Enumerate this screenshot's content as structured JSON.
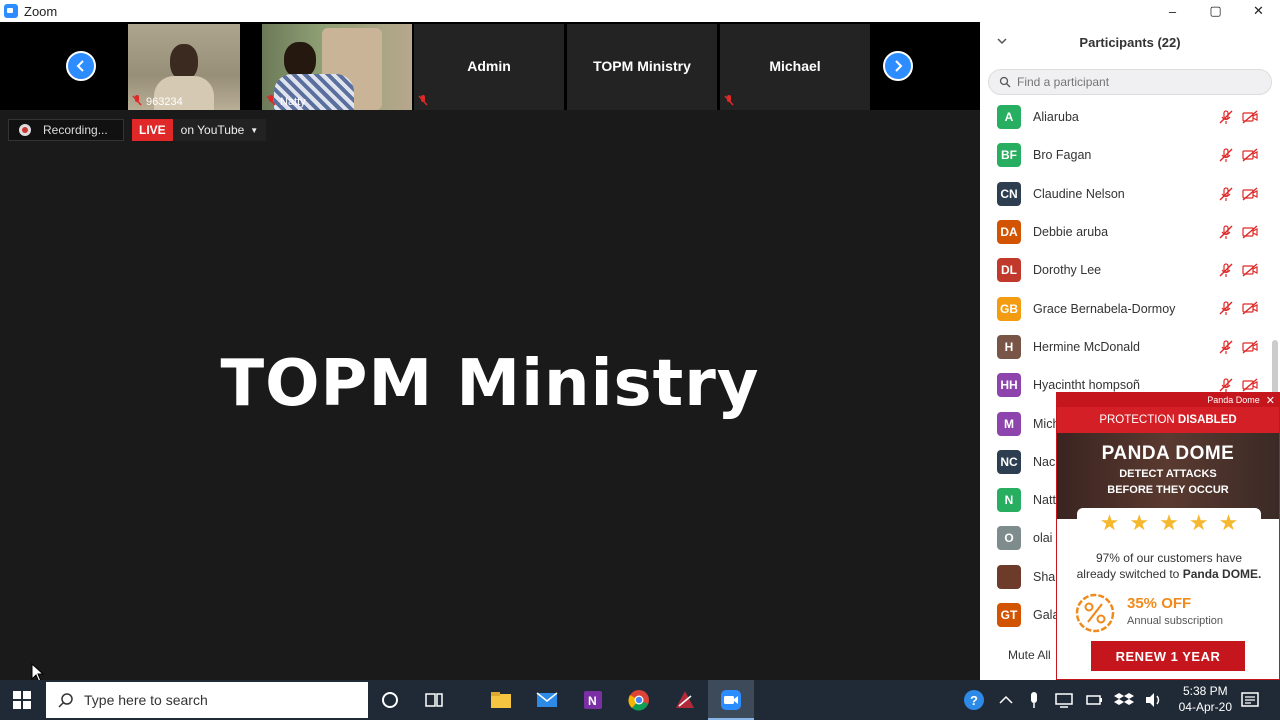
{
  "window": {
    "title": "Zoom",
    "controls": [
      "–",
      "▢",
      "✕"
    ]
  },
  "gallery": {
    "tiles": [
      {
        "name": "963234",
        "muted": true
      },
      {
        "name": "Natty",
        "muted": true
      },
      {
        "name": "Admin",
        "muted": true
      },
      {
        "name": "TOPM Ministry",
        "muted": false
      },
      {
        "name": "Michael",
        "muted": true
      }
    ]
  },
  "recording": {
    "label": "Recording..."
  },
  "live": {
    "badge": "LIVE",
    "destination": "on YouTube"
  },
  "speaker": {
    "name": "TOPM Ministry"
  },
  "participants": {
    "title": "Participants (22)",
    "search_placeholder": "Find a participant",
    "mute_all_label": "Mute All",
    "list": [
      {
        "initials": "A",
        "name": "Aliaruba",
        "color": "#27ae60"
      },
      {
        "initials": "BF",
        "name": "Bro Fagan",
        "color": "#27ae60"
      },
      {
        "initials": "CN",
        "name": "Claudine Nelson",
        "color": "#2c3e50"
      },
      {
        "initials": "DA",
        "name": "Debbie aruba",
        "color": "#d35400"
      },
      {
        "initials": "DL",
        "name": "Dorothy Lee",
        "color": "#c0392b"
      },
      {
        "initials": "GB",
        "name": "Grace Bernabela-Dormoy",
        "color": "#f39c12"
      },
      {
        "initials": "H",
        "name": "Hermine McDonald",
        "color": "#795548"
      },
      {
        "initials": "HH",
        "name": "Hyacintht hompsoñ",
        "color": "#8e44ad"
      },
      {
        "initials": "M",
        "name": "Mich",
        "color": "#8e44ad"
      },
      {
        "initials": "NC",
        "name": "Nac",
        "color": "#2c3e50"
      },
      {
        "initials": "N",
        "name": "Natt",
        "color": "#27ae60"
      },
      {
        "initials": "O",
        "name": "olai",
        "color": "#7f8c8d"
      },
      {
        "initials": "",
        "name": "Sha",
        "color": "#6d3b2a"
      },
      {
        "initials": "GT",
        "name": "Gala",
        "color": "#d35400"
      }
    ]
  },
  "panda": {
    "top_label": "Panda Dome",
    "status_prefix": "PROTECTION ",
    "status": "DISABLED",
    "brand": "PANDA DOME",
    "tagline_1": "DETECT ATTACKS",
    "tagline_2": "BEFORE THEY OCCUR",
    "stars": 5,
    "copy_1": "97% of our customers have",
    "copy_2_prefix": "already switched to ",
    "copy_2_brand": "Panda DOME.",
    "discount": "35% OFF",
    "discount_sub": "Annual subscription",
    "cta": "RENEW 1 YEAR",
    "brand_color": "#c4161c"
  },
  "taskbar": {
    "search_placeholder": "Type here to search",
    "time": "5:38 PM",
    "date": "04-Apr-20"
  }
}
